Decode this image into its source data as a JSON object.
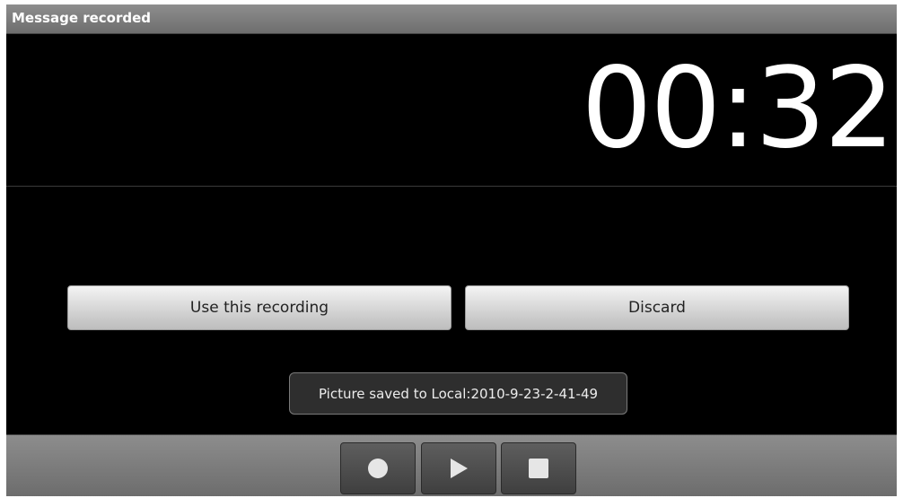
{
  "titlebar": {
    "title": "Message recorded"
  },
  "timer": {
    "value": "00:32"
  },
  "actions": {
    "use_label": "Use this recording",
    "discard_label": "Discard"
  },
  "toast": {
    "message": "Picture saved to Local:2010-9-23-2-41-49"
  },
  "controls": {
    "record_icon": "record-icon",
    "play_icon": "play-icon",
    "stop_icon": "stop-icon"
  },
  "colors": {
    "background": "#000000",
    "bar": "#7d7d7d",
    "text": "#ffffff"
  }
}
